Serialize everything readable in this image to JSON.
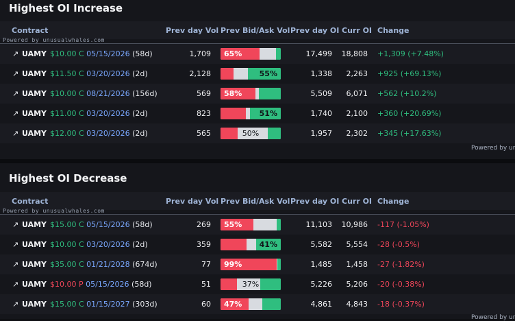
{
  "powered_by": "Powered by unusualwhales.com",
  "powered_by_right": "Powered by un",
  "columns": {
    "contract": "Contract",
    "prev_vol": "Prev day Vol",
    "bidask": "Prev Bid/Ask Vol",
    "prev_oi": "Prev day OI",
    "curr_oi": "Curr OI",
    "change": "Change"
  },
  "increase": {
    "title": "Highest OI Increase",
    "rows": [
      {
        "arrow": "↗",
        "ticker": "UAMY",
        "strike": "$10.00 C",
        "type": "call",
        "expiry": "05/15/2026",
        "dte": "(58d)",
        "prev_vol": "1,709",
        "bid_pct": 0.65,
        "ask_pct": 0.08,
        "bid_label": "65%",
        "ask_label": "",
        "mid_label": "",
        "prev_oi": "17,499",
        "curr_oi": "18,808",
        "change": "+1,309 (+7.48%)",
        "dir": "up"
      },
      {
        "arrow": "↗",
        "ticker": "UAMY",
        "strike": "$11.50 C",
        "type": "call",
        "expiry": "03/20/2026",
        "dte": "(2d)",
        "prev_vol": "2,128",
        "bid_pct": 0.22,
        "ask_pct": 0.55,
        "bid_label": "",
        "ask_label": "55%",
        "mid_label": "",
        "prev_oi": "1,338",
        "curr_oi": "2,263",
        "change": "+925 (+69.13%)",
        "dir": "up"
      },
      {
        "arrow": "↗",
        "ticker": "UAMY",
        "strike": "$10.00 C",
        "type": "call",
        "expiry": "08/21/2026",
        "dte": "(156d)",
        "prev_vol": "569",
        "bid_pct": 0.58,
        "ask_pct": 0.36,
        "bid_label": "58%",
        "ask_label": "",
        "mid_label": "",
        "prev_oi": "5,509",
        "curr_oi": "6,071",
        "change": "+562 (+10.2%)",
        "dir": "up"
      },
      {
        "arrow": "↗",
        "ticker": "UAMY",
        "strike": "$11.00 C",
        "type": "call",
        "expiry": "03/20/2026",
        "dte": "(2d)",
        "prev_vol": "823",
        "bid_pct": 0.42,
        "ask_pct": 0.51,
        "bid_label": "",
        "ask_label": "51%",
        "mid_label": "",
        "prev_oi": "1,740",
        "curr_oi": "2,100",
        "change": "+360 (+20.69%)",
        "dir": "up"
      },
      {
        "arrow": "↗",
        "ticker": "UAMY",
        "strike": "$12.00 C",
        "type": "call",
        "expiry": "03/20/2026",
        "dte": "(2d)",
        "prev_vol": "565",
        "bid_pct": 0.28,
        "ask_pct": 0.22,
        "bid_label": "",
        "ask_label": "",
        "mid_label": "50%",
        "prev_oi": "1,957",
        "curr_oi": "2,302",
        "change": "+345 (+17.63%)",
        "dir": "up"
      }
    ]
  },
  "decrease": {
    "title": "Highest OI Decrease",
    "rows": [
      {
        "arrow": "↗",
        "ticker": "UAMY",
        "strike": "$15.00 C",
        "type": "call",
        "expiry": "05/15/2026",
        "dte": "(58d)",
        "prev_vol": "269",
        "bid_pct": 0.55,
        "ask_pct": 0.07,
        "bid_label": "55%",
        "ask_label": "",
        "mid_label": "",
        "prev_oi": "11,103",
        "curr_oi": "10,986",
        "change": "-117 (-1.05%)",
        "dir": "down"
      },
      {
        "arrow": "↗",
        "ticker": "UAMY",
        "strike": "$10.00 C",
        "type": "call",
        "expiry": "03/20/2026",
        "dte": "(2d)",
        "prev_vol": "359",
        "bid_pct": 0.43,
        "ask_pct": 0.41,
        "bid_label": "",
        "ask_label": "41%",
        "mid_label": "",
        "prev_oi": "5,582",
        "curr_oi": "5,554",
        "change": "-28 (-0.5%)",
        "dir": "down"
      },
      {
        "arrow": "↗",
        "ticker": "UAMY",
        "strike": "$35.00 C",
        "type": "call",
        "expiry": "01/21/2028",
        "dte": "(674d)",
        "prev_vol": "77",
        "bid_pct": 0.93,
        "ask_pct": 0.06,
        "bid_label": "99%",
        "ask_label": "",
        "mid_label": "",
        "prev_oi": "1,485",
        "curr_oi": "1,458",
        "change": "-27 (-1.82%)",
        "dir": "down"
      },
      {
        "arrow": "↗",
        "ticker": "UAMY",
        "strike": "$10.00 P",
        "type": "put",
        "expiry": "05/15/2026",
        "dte": "(58d)",
        "prev_vol": "51",
        "bid_pct": 0.27,
        "ask_pct": 0.34,
        "bid_label": "",
        "ask_label": "",
        "mid_label": "37%",
        "prev_oi": "5,226",
        "curr_oi": "5,206",
        "change": "-20 (-0.38%)",
        "dir": "down"
      },
      {
        "arrow": "↗",
        "ticker": "UAMY",
        "strike": "$15.00 C",
        "type": "call",
        "expiry": "01/15/2027",
        "dte": "(303d)",
        "prev_vol": "60",
        "bid_pct": 0.47,
        "ask_pct": 0.31,
        "bid_label": "47%",
        "ask_label": "",
        "mid_label": "",
        "prev_oi": "4,861",
        "curr_oi": "4,843",
        "change": "-18 (-0.37%)",
        "dir": "down"
      }
    ]
  }
}
